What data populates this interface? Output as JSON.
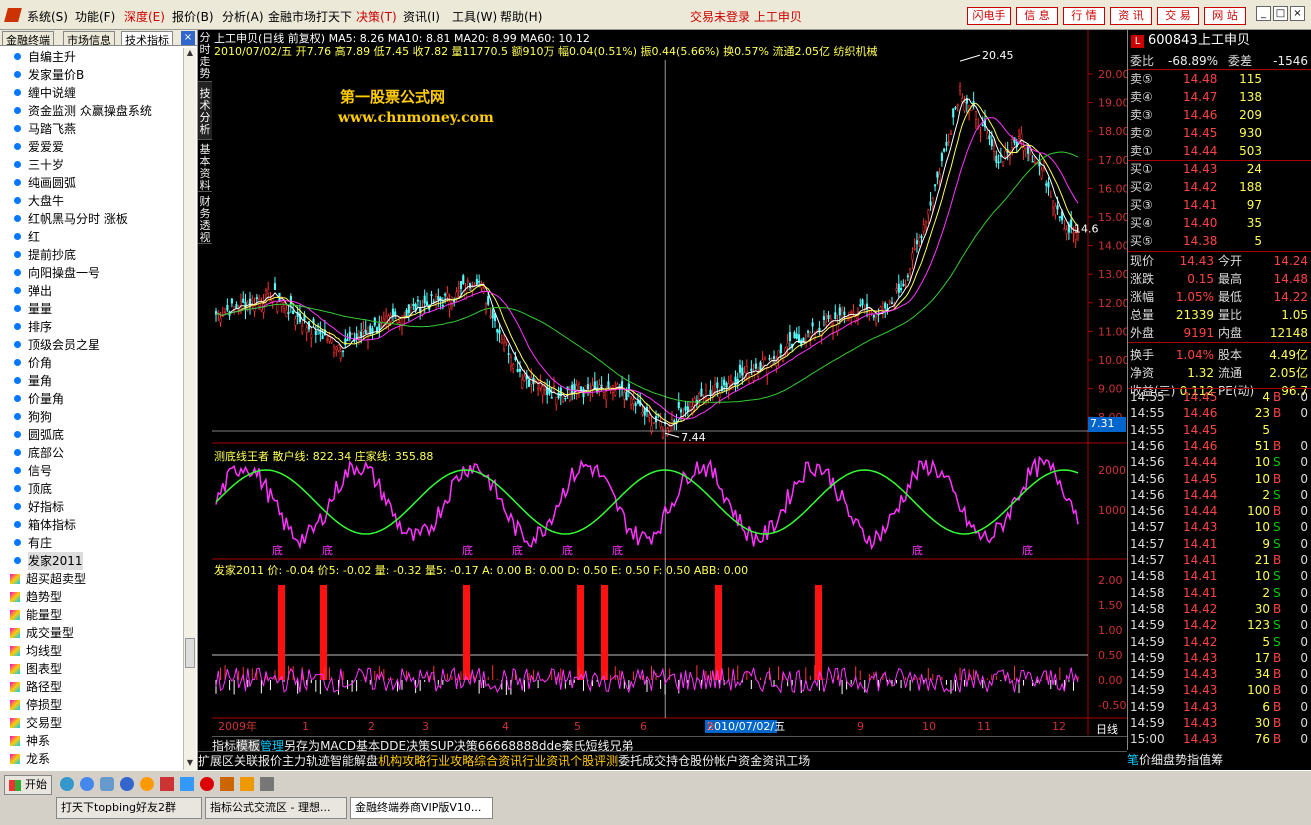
{
  "menu": {
    "items": [
      "系统(S)",
      "功能(F)",
      "深度(E)",
      "报价(B)",
      "分析(A)",
      "金融市场",
      "打天下",
      "决策(T)",
      "资讯(I)",
      "工具(W)",
      "帮助(H)"
    ],
    "status": "交易未登录  上工申贝",
    "buttons": [
      "闪电手",
      "信 息",
      "行 情",
      "资 讯",
      "交 易",
      "网 站"
    ]
  },
  "left": {
    "tabs": [
      "金融终端",
      "市场信息",
      "技术指标"
    ],
    "tree": [
      "自编主升",
      "发家量价B",
      "缠中说缠",
      "资金监测 众赢操盘系统",
      "马踏飞燕",
      "爱爱爱",
      "三十岁",
      "纯画圆弧",
      "大盘牛",
      "红帆黑马分时 涨板",
      "红",
      "提前抄底",
      "向阳操盘一号",
      "弹出",
      "量量",
      "排序",
      "顶级会员之星",
      "价角",
      "量角",
      "价量角",
      "狗狗",
      "圆弧底",
      "底部公",
      "信号",
      "顶底",
      "好指标",
      "箱体指标",
      "有庄",
      "发家2011"
    ],
    "groups": [
      "超买超卖型",
      "趋势型",
      "能量型",
      "成交量型",
      "均线型",
      "图表型",
      "路径型",
      "停损型",
      "交易型",
      "神系",
      "龙系"
    ]
  },
  "vtabs": [
    "分时走势",
    "技术分析",
    "基本资料",
    "财务透视"
  ],
  "chart": {
    "info1": "上工申贝(日线 前复权) MA5: 8.26  MA10: 8.81  MA20: 8.99  MA60: 10.12",
    "info2": "2010/07/02/五 开7.76 高7.89 低7.45 收7.82 量11770.5 额910万 幅0.04(0.51%) 振0.44(5.66%) 换0.57% 流通2.05亿 纺织机械",
    "watermark1": "第一股票公式网",
    "watermark2": "www.chnmoney.com",
    "high_label": "20.45",
    "low_label": "7.44",
    "last_label": "14.6",
    "cursor_price": "7.31",
    "yticks": [
      "20.00",
      "19.00",
      "18.00",
      "17.00",
      "16.00",
      "15.00",
      "14.00",
      "13.00",
      "12.00",
      "11.00",
      "10.00",
      "9.00",
      "8.00"
    ],
    "ind1_title": "测底线王者  散户线: 822.34  庄家线: 355.88",
    "ind1_ticks": [
      "2000",
      "1000"
    ],
    "ind1_mark": "底",
    "ind2_title": "发家2011  价: -0.04  价5: -0.02  量: -0.32  量5: -0.17     A: 0.00  B: 0.00  D: 0.50  E: 0.50  F: 0.50  ABB: 0.00",
    "ind2_ticks": [
      "2.00",
      "1.50",
      "1.00",
      "0.50",
      "0.00",
      "-0.50"
    ],
    "xlabels": [
      "2009年",
      "1",
      "2",
      "3",
      "4",
      "5",
      "6",
      "2010/07/02/五",
      "8",
      "9",
      "10",
      "11",
      "12"
    ],
    "period": "日线"
  },
  "quote": {
    "code": "600843",
    "name": "上工申贝",
    "weibi_label": "委比",
    "weibi": "-68.89%",
    "weicha_label": "委差",
    "weicha": "-1546",
    "asks": [
      [
        "卖⑤",
        "14.48",
        "115"
      ],
      [
        "卖④",
        "14.47",
        "138"
      ],
      [
        "卖③",
        "14.46",
        "209"
      ],
      [
        "卖②",
        "14.45",
        "930"
      ],
      [
        "卖①",
        "14.44",
        "503"
      ]
    ],
    "bids": [
      [
        "买①",
        "14.43",
        "24"
      ],
      [
        "买②",
        "14.42",
        "188"
      ],
      [
        "买③",
        "14.41",
        "97"
      ],
      [
        "买④",
        "14.40",
        "35"
      ],
      [
        "买⑤",
        "14.38",
        "5"
      ]
    ],
    "stats": [
      [
        "现价",
        "14.43",
        "今开",
        "14.24"
      ],
      [
        "涨跌",
        "0.15",
        "最高",
        "14.48"
      ],
      [
        "涨幅",
        "1.05%",
        "最低",
        "14.22"
      ],
      [
        "总量",
        "21339",
        "量比",
        "1.05"
      ],
      [
        "外盘",
        "9191",
        "内盘",
        "12148"
      ],
      [
        "换手",
        "1.04%",
        "股本",
        "4.49亿"
      ],
      [
        "净资",
        "1.32",
        "流通",
        "2.05亿"
      ],
      [
        "收益(三)",
        "0.112",
        "PE(动)",
        "96.7"
      ]
    ],
    "ticks": [
      [
        "14:55",
        "14.45",
        "4",
        "B",
        "0"
      ],
      [
        "14:55",
        "14.46",
        "23",
        "B",
        "0"
      ],
      [
        "14:55",
        "14.45",
        "5",
        "",
        ""
      ],
      [
        "14:56",
        "14.46",
        "51",
        "B",
        "0"
      ],
      [
        "14:56",
        "14.44",
        "10",
        "S",
        "0"
      ],
      [
        "14:56",
        "14.45",
        "10",
        "B",
        "0"
      ],
      [
        "14:56",
        "14.44",
        "2",
        "S",
        "0"
      ],
      [
        "14:56",
        "14.44",
        "100",
        "B",
        "0"
      ],
      [
        "14:57",
        "14.43",
        "10",
        "S",
        "0"
      ],
      [
        "14:57",
        "14.41",
        "9",
        "S",
        "0"
      ],
      [
        "14:57",
        "14.41",
        "21",
        "B",
        "0"
      ],
      [
        "14:58",
        "14.41",
        "10",
        "S",
        "0"
      ],
      [
        "14:58",
        "14.41",
        "2",
        "S",
        "0"
      ],
      [
        "14:58",
        "14.42",
        "30",
        "B",
        "0"
      ],
      [
        "14:59",
        "14.42",
        "123",
        "S",
        "0"
      ],
      [
        "14:59",
        "14.42",
        "5",
        "S",
        "0"
      ],
      [
        "14:59",
        "14.43",
        "17",
        "B",
        "0"
      ],
      [
        "14:59",
        "14.43",
        "34",
        "B",
        "0"
      ],
      [
        "14:59",
        "14.43",
        "100",
        "B",
        "0"
      ],
      [
        "14:59",
        "14.43",
        "6",
        "B",
        "0"
      ],
      [
        "14:59",
        "14.43",
        "30",
        "B",
        "0"
      ],
      [
        "15:00",
        "14.43",
        "76",
        "B",
        "0"
      ]
    ]
  },
  "bottom": {
    "row1": [
      "指标",
      "模板",
      "管理",
      "另存为",
      "MACD基本",
      "DDE决策",
      "SUP决策",
      "6666",
      "8888",
      "dde",
      "秦氏",
      "短线",
      "兄弟"
    ],
    "row2": [
      "扩展区",
      "关联报价",
      "主力轨迹",
      "智能解盘",
      "机构攻略",
      "行业攻略",
      "综合资讯",
      "行业资讯",
      "个股评测",
      "委托成交",
      "持仓股份",
      "帐户资金"
    ],
    "right": "资讯工场",
    "rtabs": [
      "笔",
      "价",
      "细",
      "盘",
      "势",
      "指",
      "值",
      "筹"
    ]
  },
  "taskbar": {
    "start": "开始",
    "tasks": [
      "打天下topbing好友2群",
      "指标公式交流区 - 理想...",
      "金融终端券商VIP版V10..."
    ]
  }
}
